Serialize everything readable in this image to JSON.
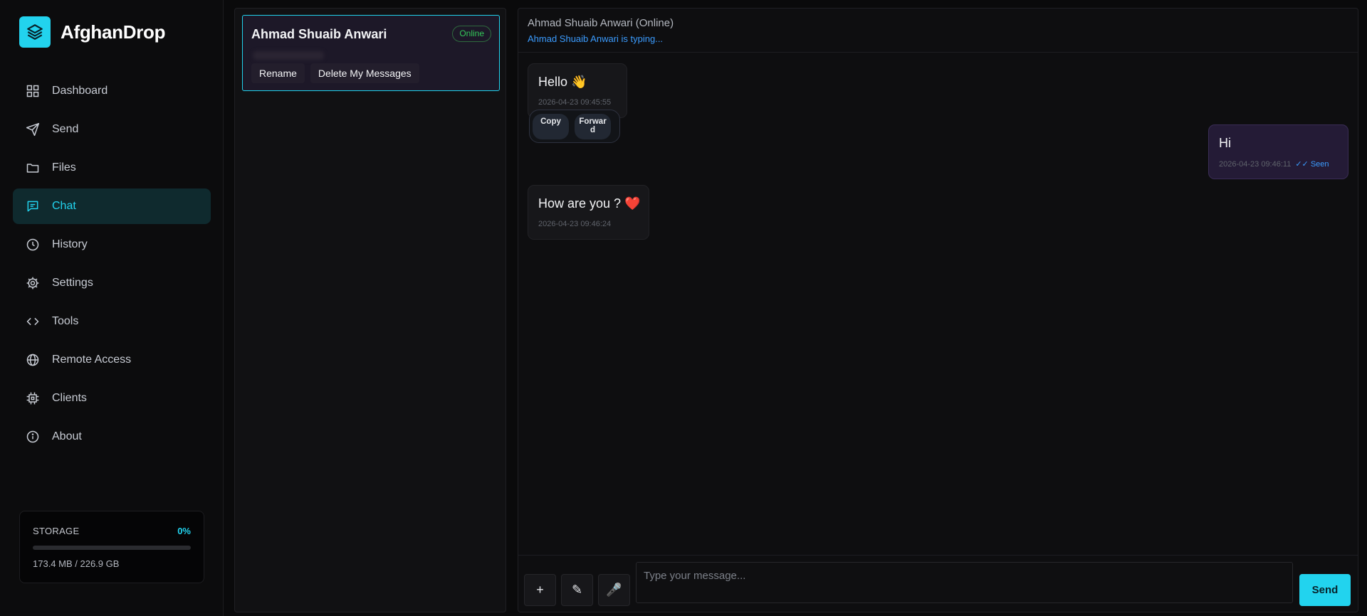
{
  "app": {
    "name": "AfghanDrop",
    "accent": "#22d3ee"
  },
  "nav": [
    {
      "label": "Dashboard",
      "icon": "dashboard-icon"
    },
    {
      "label": "Send",
      "icon": "send-icon"
    },
    {
      "label": "Files",
      "icon": "folder-icon"
    },
    {
      "label": "Chat",
      "icon": "chat-icon",
      "active": true
    },
    {
      "label": "History",
      "icon": "clock-icon"
    },
    {
      "label": "Settings",
      "icon": "gear-icon"
    },
    {
      "label": "Tools",
      "icon": "code-icon"
    },
    {
      "label": "Remote Access",
      "icon": "globe-icon"
    },
    {
      "label": "Clients",
      "icon": "chip-icon"
    },
    {
      "label": "About",
      "icon": "info-icon"
    }
  ],
  "storage": {
    "title": "STORAGE",
    "percent": "0%",
    "used_fraction": 0,
    "text": "173.4 MB / 226.9 GB"
  },
  "contact": {
    "name": "Ahmad Shuaib Anwari",
    "status": "Online",
    "rename_label": "Rename",
    "delete_label": "Delete My Messages"
  },
  "chat": {
    "title": "Ahmad Shuaib Anwari (Online)",
    "typing": "Ahmad Shuaib Anwari is typing...",
    "messages": [
      {
        "direction": "in",
        "text": "Hello 👋",
        "time": "2026-04-23 09:45:55"
      },
      {
        "direction": "out",
        "text": "Hi",
        "time": "2026-04-23 09:46:11",
        "seen": "✓✓ Seen"
      },
      {
        "direction": "in",
        "text": "How are you ? ❤️",
        "time": "2026-04-23 09:46:24"
      }
    ],
    "menu": {
      "copy_label": "Copy",
      "forward_label": "Forward"
    }
  },
  "composer": {
    "add_label": "+",
    "draw_label": "✎",
    "mic_label": "🎤",
    "placeholder": "Type your message...",
    "value": "",
    "send_label": "Send"
  }
}
